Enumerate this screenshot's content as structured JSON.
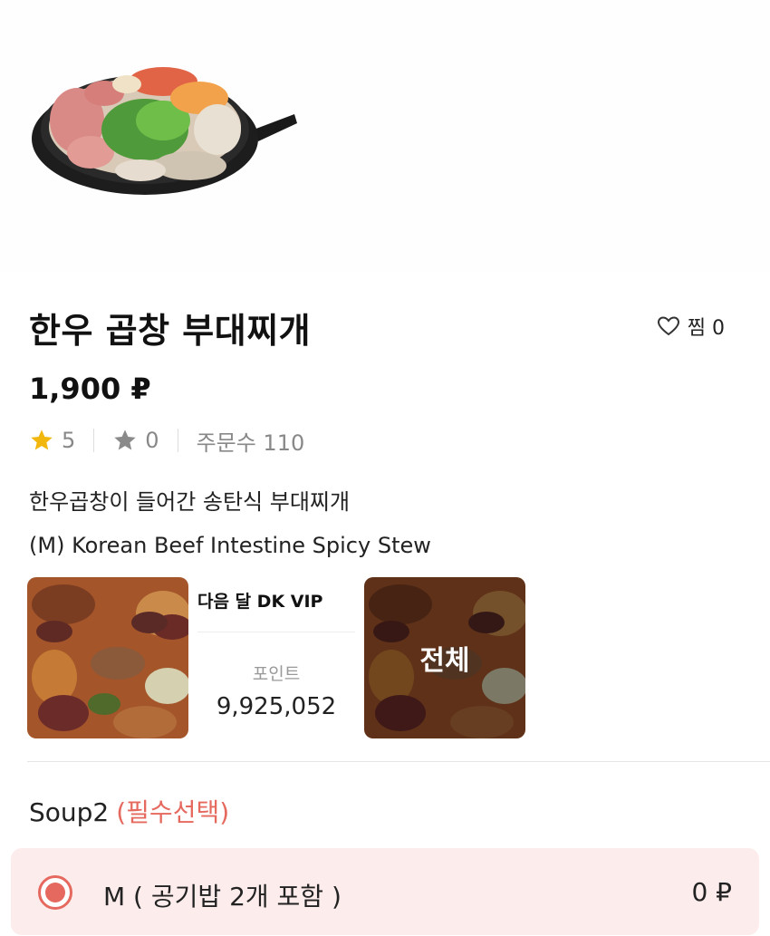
{
  "product": {
    "title": "한우 곱창 부대찌개",
    "favorite_label": "찜 0",
    "price": "1,900 ₽",
    "rating": "5",
    "rating_count": "0",
    "order_count": "주문수 110",
    "description_kr": "한우곱창이 들어간 송탄식 부대찌개",
    "description_en": "(M) Korean Beef Intestine Spicy Stew"
  },
  "promo": {
    "head": "다음 달 DK VIP",
    "points_label": "포인트",
    "points_value": "9,925,052",
    "overlay_text": "전체"
  },
  "options": {
    "section_title": "Soup2",
    "section_required": "(필수선택)",
    "items": [
      {
        "label": "M ( 공기밥 2개 포함 )",
        "price": "0 ₽",
        "selected": true
      }
    ]
  },
  "colors": {
    "accent": "#e5695e",
    "option_bg": "#fdecec",
    "star": "#f2b70f"
  },
  "icons": {
    "favorite": "heart-outline-icon",
    "rating": "star-filled-icon",
    "rating_count": "star-gray-icon"
  }
}
